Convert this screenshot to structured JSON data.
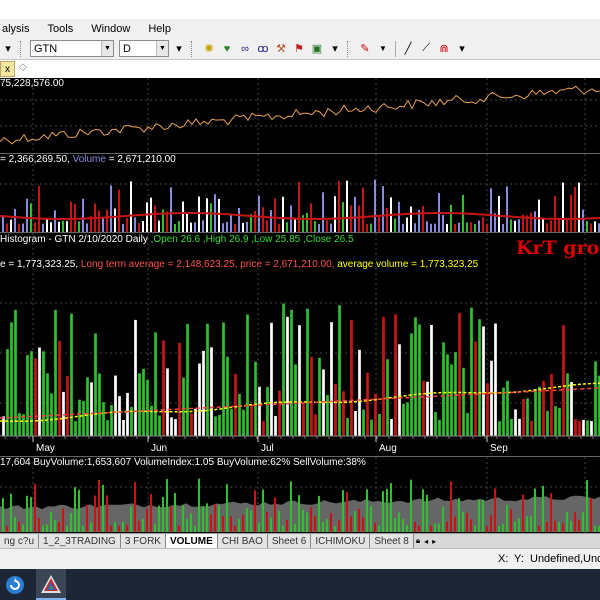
{
  "menu": [
    "alysis",
    "Tools",
    "Window",
    "Help"
  ],
  "toolbar": {
    "symbol": "GTN",
    "period": "D"
  },
  "tab": {
    "close": "x",
    "extra": "◇"
  },
  "pane1": {
    "label": "75,228,576.00",
    "line_color": "#e8a050"
  },
  "pane2": {
    "label_prefix": "= 2,366,269.50, ",
    "label_volume_key": "Volume",
    "label_volume_val": " = 2,671,210.00"
  },
  "pane3": {
    "title": "Histogram - GTN  2/10/2020  Daily",
    "open": " ,Open 26.6",
    "high": " ,High 26.9",
    "low": " ,Low 25.85",
    "close": " ,Close 26.5",
    "line2_a": "e = 1,773,323.25, ",
    "line2_b": "Long term average = 2,148,623.25, ",
    "line2_c": "price = 2,671,210.00, ",
    "line2_d": "average volume = 1,773,323.25",
    "watermark": "KrT group",
    "months": [
      "May",
      "Jun",
      "Jul",
      "Aug",
      "Sep"
    ]
  },
  "pane4": {
    "label": "17,604  BuyVolume:1,653,607  VolumeIndex:1.05  BuyVolume:62%  SellVolume:38%"
  },
  "sheet_tabs": [
    "ng c?u",
    "1_2_3TRADING",
    "3 FORK",
    "VOLUME",
    "CHI BAO",
    "Sheet 6",
    "ICHIMOKU",
    "Sheet 8"
  ],
  "sheet_active": "VOLUME",
  "status": {
    "x": "X:",
    "y": "Y:",
    "u1": "Undefined,",
    "u2": "Undef"
  },
  "colors": {
    "green": "#2fbf2f",
    "red": "#c81414",
    "white": "#ffffff",
    "purple": "#8a8ae0",
    "yellow": "#ffff00"
  }
}
